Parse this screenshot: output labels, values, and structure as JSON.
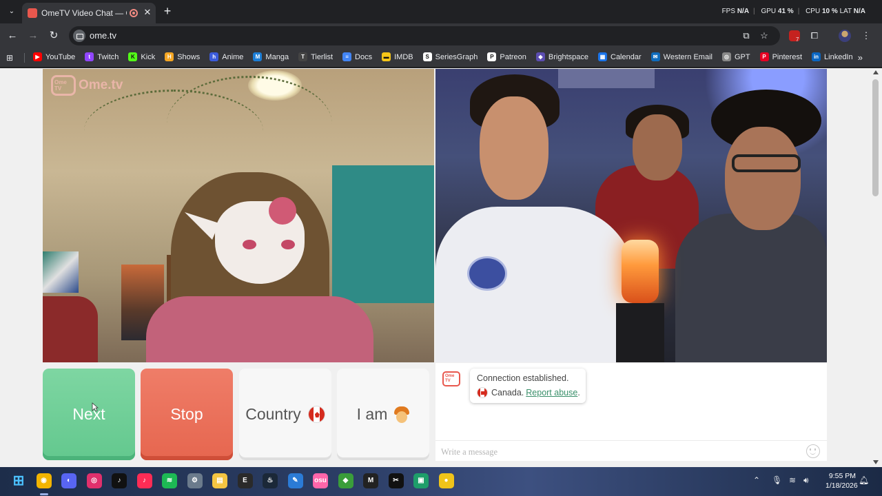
{
  "browser": {
    "tab_title": "OmeTV Video Chat — Ome",
    "url": "ome.tv",
    "perf": {
      "fps_label": "FPS",
      "fps_value": "N/A",
      "gpu_label": "GPU",
      "gpu_value": "41 %",
      "cpu_label": "CPU",
      "cpu_value": "10 %",
      "lat_label": "LAT",
      "lat_value": "N/A"
    },
    "extension_badge": "7",
    "bookmarks": [
      {
        "label": "YouTube",
        "icon": "youtube-icon",
        "color": "#ff0000",
        "glyph": "▶"
      },
      {
        "label": "Twitch",
        "icon": "twitch-icon",
        "color": "#9146ff",
        "glyph": "t"
      },
      {
        "label": "Kick",
        "icon": "kick-icon",
        "color": "#53fc18",
        "glyph": "K"
      },
      {
        "label": "Shows",
        "icon": "shows-icon",
        "color": "#f5a623",
        "glyph": "H"
      },
      {
        "label": "Anime",
        "icon": "anime-icon",
        "color": "#3b5bdb",
        "glyph": "h"
      },
      {
        "label": "Manga",
        "icon": "manga-icon",
        "color": "#1c7ed6",
        "glyph": "M"
      },
      {
        "label": "Tierlist",
        "icon": "tierlist-icon",
        "color": "#444444",
        "glyph": "T"
      },
      {
        "label": "Docs",
        "icon": "docs-icon",
        "color": "#4285f4",
        "glyph": "≡"
      },
      {
        "label": "IMDB",
        "icon": "imdb-icon",
        "color": "#f5c518",
        "glyph": "▬"
      },
      {
        "label": "SeriesGraph",
        "icon": "seriesgraph-icon",
        "color": "#ffffff",
        "glyph": "S"
      },
      {
        "label": "Patreon",
        "icon": "patreon-icon",
        "color": "#ffffff",
        "glyph": "P"
      },
      {
        "label": "Brightspace",
        "icon": "brightspace-icon",
        "color": "#5c4db1",
        "glyph": "◆"
      },
      {
        "label": "Calendar",
        "icon": "calendar-icon",
        "color": "#1a73e8",
        "glyph": "▦"
      },
      {
        "label": "Western Email",
        "icon": "email-icon",
        "color": "#0f6cbd",
        "glyph": "✉"
      },
      {
        "label": "GPT",
        "icon": "gpt-icon",
        "color": "#888888",
        "glyph": "◎"
      },
      {
        "label": "Pinterest",
        "icon": "pinterest-icon",
        "color": "#e60023",
        "glyph": "P"
      },
      {
        "label": "LinkedIn",
        "icon": "linkedin-icon",
        "color": "#0a66c2",
        "glyph": "in"
      }
    ]
  },
  "page": {
    "logo_badge": "Ome TV",
    "logo_text": "Ome.tv",
    "buttons": {
      "next": "Next",
      "stop": "Stop",
      "country": "Country",
      "iam": "I am"
    },
    "chat": {
      "logo_badge": "Ome TV",
      "message_line1": "Connection established.",
      "country": "Canada.",
      "report_link": "Report abuse",
      "period": ".",
      "placeholder": "Write a message"
    },
    "colors": {
      "next": "#6ccf96",
      "stop": "#ea6f58",
      "link": "#3a8f6a"
    }
  },
  "taskbar": {
    "apps": [
      "windows-start-icon",
      "chrome-icon",
      "discord-icon",
      "instagram-icon",
      "tiktok-icon",
      "tiktok-alt-icon",
      "spotify-icon",
      "settings-icon",
      "file-explorer-icon",
      "epic-games-icon",
      "steam-icon",
      "vscode-icon",
      "osu-icon",
      "game-icon",
      "launcher-icon",
      "capcut-icon",
      "app-icon",
      "circle-app-icon"
    ],
    "time": "9:55 PM",
    "date": "1/18/2026"
  }
}
